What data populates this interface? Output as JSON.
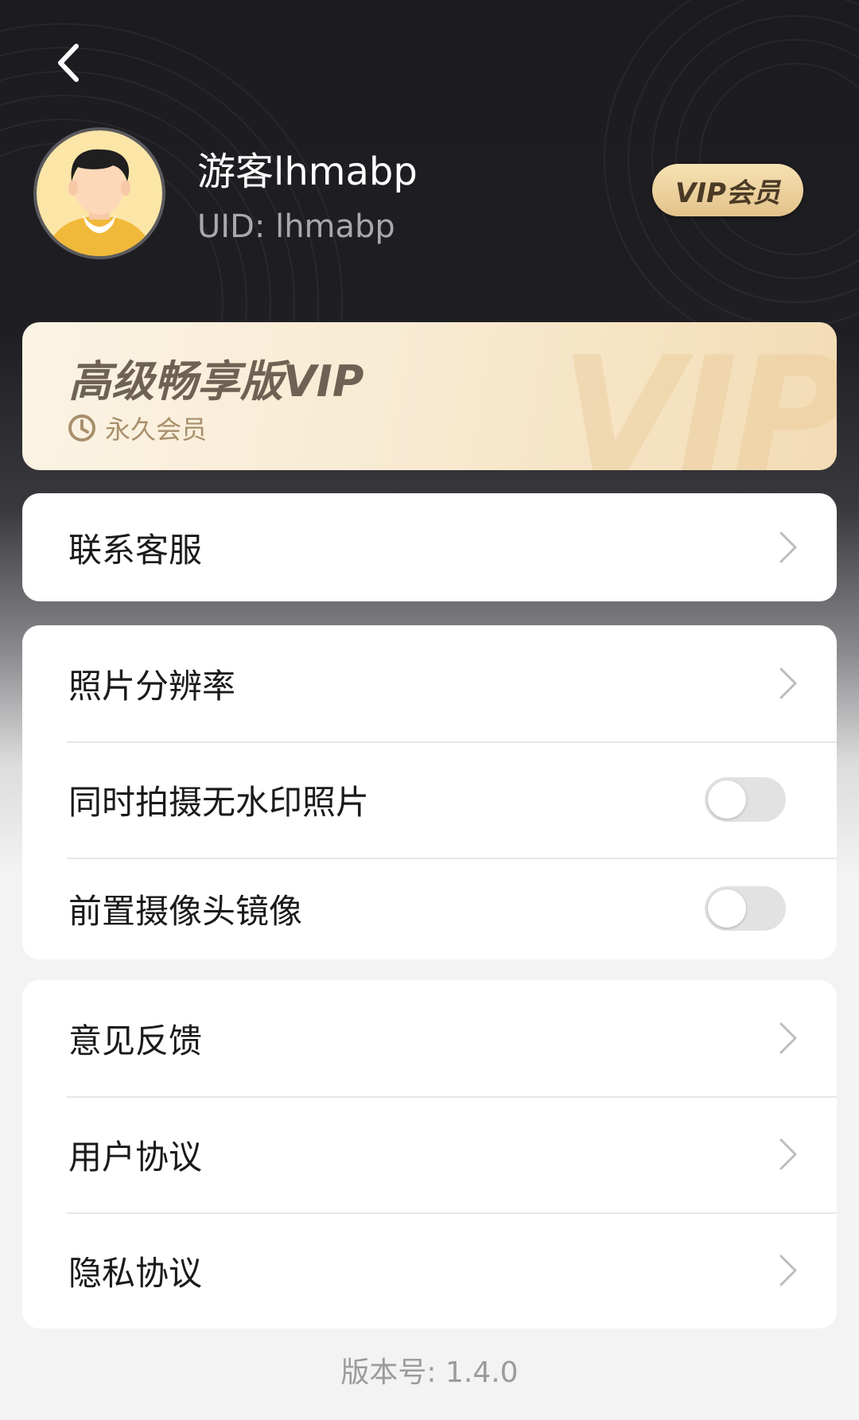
{
  "header": {
    "back_icon": "chevron-left-icon",
    "username": "游客lhmabp",
    "uid_label": "UID:",
    "uid_value": "lhmabp",
    "vip_badge": "VIP会员"
  },
  "vip_card": {
    "title": "高级畅享版VIP",
    "subtitle_icon": "clock-icon",
    "subtitle": "永久会员",
    "watermark": "VIP"
  },
  "groups": [
    {
      "items": [
        {
          "label": "联系客服",
          "control": "chevron"
        }
      ]
    },
    {
      "items": [
        {
          "label": "照片分辨率",
          "control": "chevron"
        },
        {
          "label": "同时拍摄无水印照片",
          "control": "toggle",
          "on": false
        },
        {
          "label": "前置摄像头镜像",
          "control": "toggle",
          "on": false
        }
      ]
    },
    {
      "items": [
        {
          "label": "意见反馈",
          "control": "chevron"
        },
        {
          "label": "用户协议",
          "control": "chevron"
        },
        {
          "label": "隐私协议",
          "control": "chevron"
        }
      ]
    }
  ],
  "footer": {
    "version": "版本号: 1.4.0"
  },
  "colors": {
    "accent_gold": "#e3c28a",
    "dark_bg": "#1c1c20",
    "toggle_off": "#e2e2e2"
  }
}
